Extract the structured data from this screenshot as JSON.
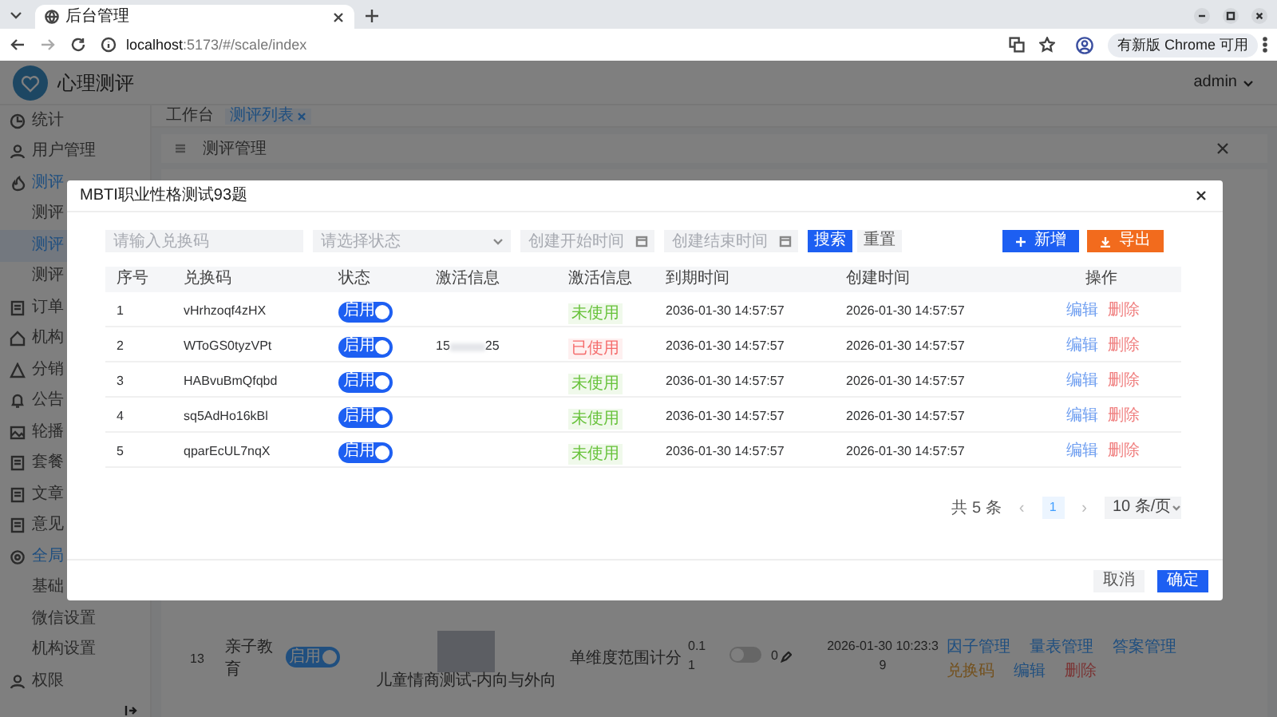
{
  "browser": {
    "tab_title": "后台管理",
    "url_host": "localhost",
    "url_rest": ":5173/#/scale/index",
    "update_pill": "有新版 Chrome 可用"
  },
  "app": {
    "title": "心理测评",
    "user": "admin"
  },
  "sidebar": {
    "items": [
      {
        "label": "统计",
        "expanded": false
      },
      {
        "label": "用户管理",
        "expanded": false
      },
      {
        "label": "测评",
        "expanded": true,
        "children": [
          {
            "label": "测评",
            "selected": false
          },
          {
            "label": "测评",
            "selected": true
          },
          {
            "label": "测评",
            "selected": false
          }
        ]
      },
      {
        "label": "订单",
        "expanded": false
      },
      {
        "label": "机构",
        "expanded": false
      },
      {
        "label": "分销",
        "expanded": false
      },
      {
        "label": "公告",
        "expanded": false
      },
      {
        "label": "轮播",
        "expanded": false
      },
      {
        "label": "套餐",
        "expanded": false
      },
      {
        "label": "文章",
        "expanded": false
      },
      {
        "label": "意见",
        "expanded": false
      },
      {
        "label": "全局",
        "expanded": true,
        "children": [
          {
            "label": "基础",
            "selected": false
          },
          {
            "label": "微信设置",
            "selected": false
          },
          {
            "label": "机构设置",
            "selected": false
          }
        ]
      },
      {
        "label": "权限",
        "expanded": false
      }
    ]
  },
  "page_tabs": [
    {
      "label": "工作台",
      "selected": false
    },
    {
      "label": "测评列表",
      "selected": true
    }
  ],
  "breadcrumb": "测评管理",
  "background_row": {
    "index": "13",
    "category": "亲子教育",
    "toggle": {
      "label": "启用",
      "on": true
    },
    "caption": "儿童情商测试-内向与外向",
    "scoring": "单维度范围计分",
    "price_1": "0.1",
    "price_2": "1",
    "switch_on": false,
    "count": "0",
    "time_1": "2026-01-30 10:23:3",
    "time_2": "9",
    "links": [
      {
        "label": "因子管理",
        "kind": "link"
      },
      {
        "label": "量表管理",
        "kind": "link"
      },
      {
        "label": "答案管理",
        "kind": "link"
      },
      {
        "label": "兑换码",
        "kind": "warning"
      },
      {
        "label": "编辑",
        "kind": "link"
      },
      {
        "label": "删除",
        "kind": "danger"
      }
    ]
  },
  "dialog": {
    "title": "MBTI职业性格测试93题",
    "filters": {
      "code_placeholder": "请输入兑换码",
      "status_placeholder": "请选择状态",
      "start_placeholder": "创建开始时间",
      "end_placeholder": "创建结束时间"
    },
    "buttons": [
      {
        "label": "搜索",
        "kind": "primary"
      },
      {
        "label": "重置",
        "kind": "plain"
      },
      {
        "label": "新增",
        "kind": "add"
      },
      {
        "label": "导出",
        "kind": "export"
      }
    ],
    "table": {
      "columns": [
        "序号",
        "兑换码",
        "状态",
        "激活信息",
        "激活信息",
        "到期时间",
        "创建时间",
        "操作"
      ],
      "rows": [
        {
          "index": "1",
          "code": "vHrhzoqf4zHX",
          "toggle": {
            "label": "启用",
            "on": true
          },
          "tag": {
            "label": "未使用",
            "kind": "unused"
          },
          "expires": "2036-01-30 14:57:57",
          "created": "2026-01-30 14:57:57",
          "actions": [
            "编辑",
            "删除"
          ]
        },
        {
          "index": "2",
          "code": "WToGS0tyzVPt",
          "toggle": {
            "label": "启用",
            "on": true
          },
          "activation_head": "15",
          "activation_tail": "25",
          "tag": {
            "label": "已使用",
            "kind": "used"
          },
          "expires": "2036-01-30 14:57:57",
          "created": "2026-01-30 14:57:57",
          "actions": [
            "编辑",
            "删除"
          ]
        },
        {
          "index": "3",
          "code": "HABvuBmQfqbd",
          "toggle": {
            "label": "启用",
            "on": true
          },
          "tag": {
            "label": "未使用",
            "kind": "unused"
          },
          "expires": "2036-01-30 14:57:57",
          "created": "2026-01-30 14:57:57",
          "actions": [
            "编辑",
            "删除"
          ]
        },
        {
          "index": "4",
          "code": "sq5AdHo16kBl",
          "toggle": {
            "label": "启用",
            "on": true
          },
          "tag": {
            "label": "未使用",
            "kind": "unused"
          },
          "expires": "2036-01-30 14:57:57",
          "created": "2026-01-30 14:57:57",
          "actions": [
            "编辑",
            "删除"
          ]
        },
        {
          "index": "5",
          "code": "qparEcUL7nqX",
          "toggle": {
            "label": "启用",
            "on": true
          },
          "tag": {
            "label": "未使用",
            "kind": "unused"
          },
          "expires": "2036-01-30 14:57:57",
          "created": "2026-01-30 14:57:57",
          "actions": [
            "编辑",
            "删除"
          ]
        }
      ]
    },
    "pagination": {
      "total": "共 5 条",
      "prev": "‹",
      "pages": [
        {
          "label": "1",
          "selected": true
        }
      ],
      "next": "›",
      "page_size": "10 条/页"
    },
    "footer": [
      {
        "label": "取消",
        "kind": "plain"
      },
      {
        "label": "确定",
        "kind": "primary"
      }
    ]
  }
}
